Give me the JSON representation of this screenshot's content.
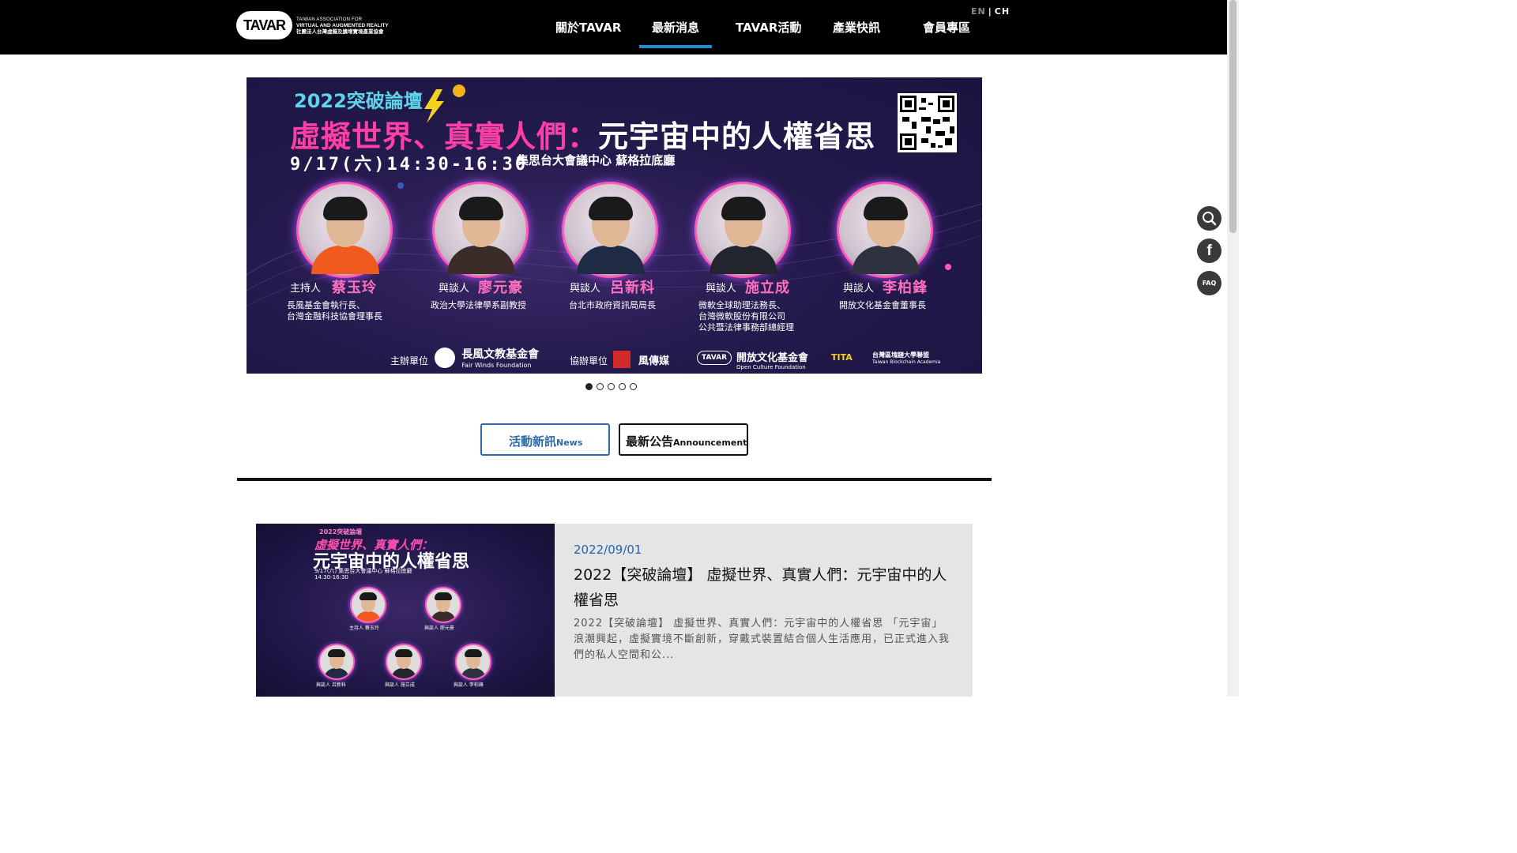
{
  "header": {
    "logo_mark": "TAVAR",
    "logo_line1": "TAIWAN ASSOCIATION FOR",
    "logo_line2": "VIRTUAL AND AUGMENTED REALITY",
    "logo_line3": "社團法人台灣虛擬及擴增實境產業協會",
    "nav": [
      {
        "label": "關於TAVAR"
      },
      {
        "label": "最新消息",
        "active": true
      },
      {
        "label": "TAVAR活動"
      },
      {
        "label": "產業快訊"
      },
      {
        "label": "會員專區"
      }
    ],
    "lang_en": "EN",
    "lang_sep": "|",
    "lang_ch": "CH",
    "active_color": "#1f8fd0"
  },
  "banner": {
    "year_label": "2022突破論壇",
    "title_pink": "虛擬世界、真實人們：",
    "title_white": "元宇宙中的人權省思",
    "date": "9/17(六)14:30-16:30",
    "venue": "集思台大會議中心 蘇格拉底廳",
    "speakers": [
      {
        "role": "主持人",
        "name": "蔡玉玲",
        "desc": [
          "長風基金會執行長、",
          "台灣金融科技協會理事長"
        ],
        "shirt_color": "#f05a1e"
      },
      {
        "role": "與談人",
        "name": "廖元豪",
        "desc": [
          "政治大學法律學系副教授"
        ],
        "shirt_color": "#3a2c28"
      },
      {
        "role": "與談人",
        "name": "呂新科",
        "desc": [
          "台北市政府資訊局局長"
        ],
        "shirt_color": "#1f2a44"
      },
      {
        "role": "與談人",
        "name": "施立成",
        "desc": [
          "微軟全球助理法務長、",
          "台灣微軟股份有限公司",
          "公共暨法律事務部總經理"
        ],
        "shirt_color": "#22242e"
      },
      {
        "role": "與談人",
        "name": "李柏鋒",
        "desc": [
          "開放文化基金會董事長"
        ],
        "shirt_color": "#2e3140"
      }
    ],
    "host_label": "主辦單位",
    "host_org": "長風文教基金會",
    "host_org_en": "Fair Winds Foundation",
    "co_label": "協辦單位",
    "co_orgs": [
      "風傳媒",
      "TAVAR",
      "開放文化基金會",
      "Open Culture Foundation",
      "TITA",
      "台灣區塊鏈大學聯盟",
      "Taiwan Blockchain Academia"
    ]
  },
  "carousel": {
    "count": 5,
    "active_index": 0
  },
  "side_buttons": {
    "search_icon": "search-icon",
    "facebook_label": "f",
    "faq_label": "FAQ"
  },
  "tabs": {
    "news_zh": "活動新訊",
    "news_en": "News",
    "ann_zh": "最新公告",
    "ann_en": "Announcement"
  },
  "article": {
    "thumb": {
      "small": "2022突破論壇",
      "title1": "虛擬世界、真實人們：",
      "title2": "元宇宙中的人權省思",
      "meta1": "9/17(六)  集思台大會議中心 蘇格拉底廳",
      "meta2": "14:30-16:30",
      "caps": [
        "主持人 蔡玉玲",
        "與談人 廖元豪",
        "與談人 呂新科",
        "與談人 施立成",
        "與談人 李柏鋒"
      ]
    },
    "date": "2022/09/01",
    "title": "2022【突破論壇】 虛擬世界、真實人們：元宇宙中的人權省思",
    "excerpt": "2022【突破論壇】 虛擬世界、真實人們：元宇宙中的人權省思 「元宇宙」浪潮興起，虛擬實境不斷創新，穿戴式裝置結合個人生活應用，已正式進入我們的私人空間和公..."
  }
}
